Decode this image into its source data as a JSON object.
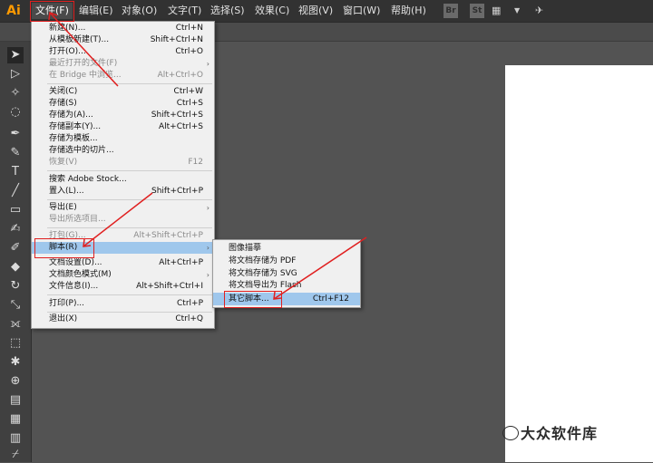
{
  "app": {
    "logo": "Ai"
  },
  "menubar": {
    "items": [
      "文件(F)",
      "编辑(E)",
      "对象(O)",
      "文字(T)",
      "选择(S)",
      "效果(C)",
      "视图(V)",
      "窗口(W)",
      "帮助(H)"
    ],
    "bridge_label": "Br",
    "stock_label": "St"
  },
  "file_menu": {
    "items": [
      {
        "label": "新建(N)...",
        "shortcut": "Ctrl+N",
        "disabled": false
      },
      {
        "label": "从模板新建(T)...",
        "shortcut": "Shift+Ctrl+N",
        "disabled": false
      },
      {
        "label": "打开(O)...",
        "shortcut": "Ctrl+O",
        "disabled": false
      },
      {
        "label": "最近打开的文件(F)",
        "shortcut": "",
        "disabled": true,
        "submenu": true
      },
      {
        "label": "在 Bridge 中浏览...",
        "shortcut": "Alt+Ctrl+O",
        "disabled": true
      },
      {
        "label": "关闭(C)",
        "shortcut": "Ctrl+W",
        "disabled": false
      },
      {
        "label": "存储(S)",
        "shortcut": "Ctrl+S",
        "disabled": false
      },
      {
        "label": "存储为(A)...",
        "shortcut": "Shift+Ctrl+S",
        "disabled": false
      },
      {
        "label": "存储副本(Y)...",
        "shortcut": "Alt+Ctrl+S",
        "disabled": false
      },
      {
        "label": "存储为模板...",
        "shortcut": "",
        "disabled": false
      },
      {
        "label": "存储选中的切片...",
        "shortcut": "",
        "disabled": false
      },
      {
        "label": "恢复(V)",
        "shortcut": "F12",
        "disabled": true
      },
      {
        "label": "搜索 Adobe Stock...",
        "shortcut": "",
        "disabled": false
      },
      {
        "label": "置入(L)...",
        "shortcut": "Shift+Ctrl+P",
        "disabled": false
      },
      {
        "label": "导出(E)",
        "shortcut": "",
        "disabled": false,
        "submenu": true
      },
      {
        "label": "导出所选项目...",
        "shortcut": "",
        "disabled": true
      },
      {
        "label": "打包(G)...",
        "shortcut": "Alt+Shift+Ctrl+P",
        "disabled": true
      },
      {
        "label": "脚本(R)",
        "shortcut": "",
        "disabled": false,
        "submenu": true,
        "highlighted": true
      },
      {
        "label": "文档设置(D)...",
        "shortcut": "Alt+Ctrl+P",
        "disabled": false
      },
      {
        "label": "文档颜色模式(M)",
        "shortcut": "",
        "disabled": false,
        "submenu": true
      },
      {
        "label": "文件信息(I)...",
        "shortcut": "Alt+Shift+Ctrl+I",
        "disabled": false
      },
      {
        "label": "打印(P)...",
        "shortcut": "Ctrl+P",
        "disabled": false
      },
      {
        "label": "退出(X)",
        "shortcut": "Ctrl+Q",
        "disabled": false
      }
    ]
  },
  "script_submenu": {
    "items": [
      {
        "label": "图像描摹",
        "shortcut": ""
      },
      {
        "label": "将文档存储为 PDF",
        "shortcut": ""
      },
      {
        "label": "将文档存储为 SVG",
        "shortcut": ""
      },
      {
        "label": "将文档导出为 Flash",
        "shortcut": ""
      },
      {
        "label": "其它脚本...",
        "shortcut": "Ctrl+F12",
        "highlighted": true
      }
    ]
  },
  "watermark": {
    "text": "大众软件库"
  },
  "colors": {
    "accent": "#FF9A00",
    "highlight": "#9fc7ec",
    "annotation": "#e02020"
  }
}
